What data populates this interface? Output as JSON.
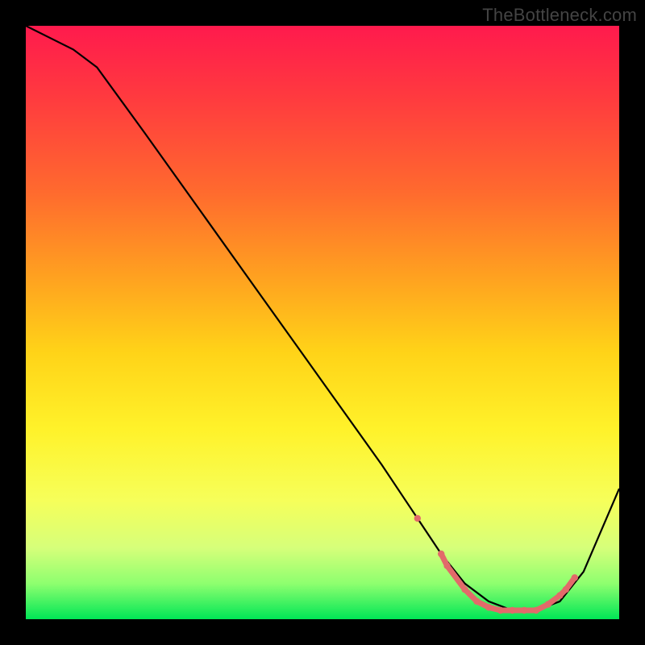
{
  "watermark": "TheBottleneck.com",
  "colors": {
    "gradient_top": "#ff1a4d",
    "gradient_bottom": "#00e656",
    "curve": "#000000",
    "marker": "#e26a6a",
    "frame": "#000000"
  },
  "chart_data": {
    "type": "line",
    "title": "",
    "xlabel": "",
    "ylabel": "",
    "xlim": [
      0,
      100
    ],
    "ylim": [
      0,
      100
    ],
    "grid": false,
    "series": [
      {
        "name": "curve",
        "x": [
          0,
          4,
          8,
          12,
          20,
          30,
          40,
          50,
          60,
          66,
          70,
          74,
          78,
          82,
          86,
          90,
          94,
          100
        ],
        "values": [
          100,
          98,
          96,
          93,
          82,
          68,
          54,
          40,
          26,
          17,
          11,
          6,
          3,
          1.5,
          1.5,
          3,
          8,
          22
        ]
      }
    ],
    "markers": [
      {
        "x": 66,
        "y": 17
      },
      {
        "x": 70,
        "y": 11
      },
      {
        "x": 71,
        "y": 9
      },
      {
        "x": 74,
        "y": 5
      },
      {
        "x": 76,
        "y": 3
      },
      {
        "x": 78,
        "y": 2
      },
      {
        "x": 80,
        "y": 1.5
      },
      {
        "x": 82,
        "y": 1.5
      },
      {
        "x": 84,
        "y": 1.5
      },
      {
        "x": 86,
        "y": 1.5
      },
      {
        "x": 88,
        "y": 2.5
      },
      {
        "x": 90,
        "y": 4
      },
      {
        "x": 91,
        "y": 5
      },
      {
        "x": 92.5,
        "y": 7
      }
    ]
  }
}
